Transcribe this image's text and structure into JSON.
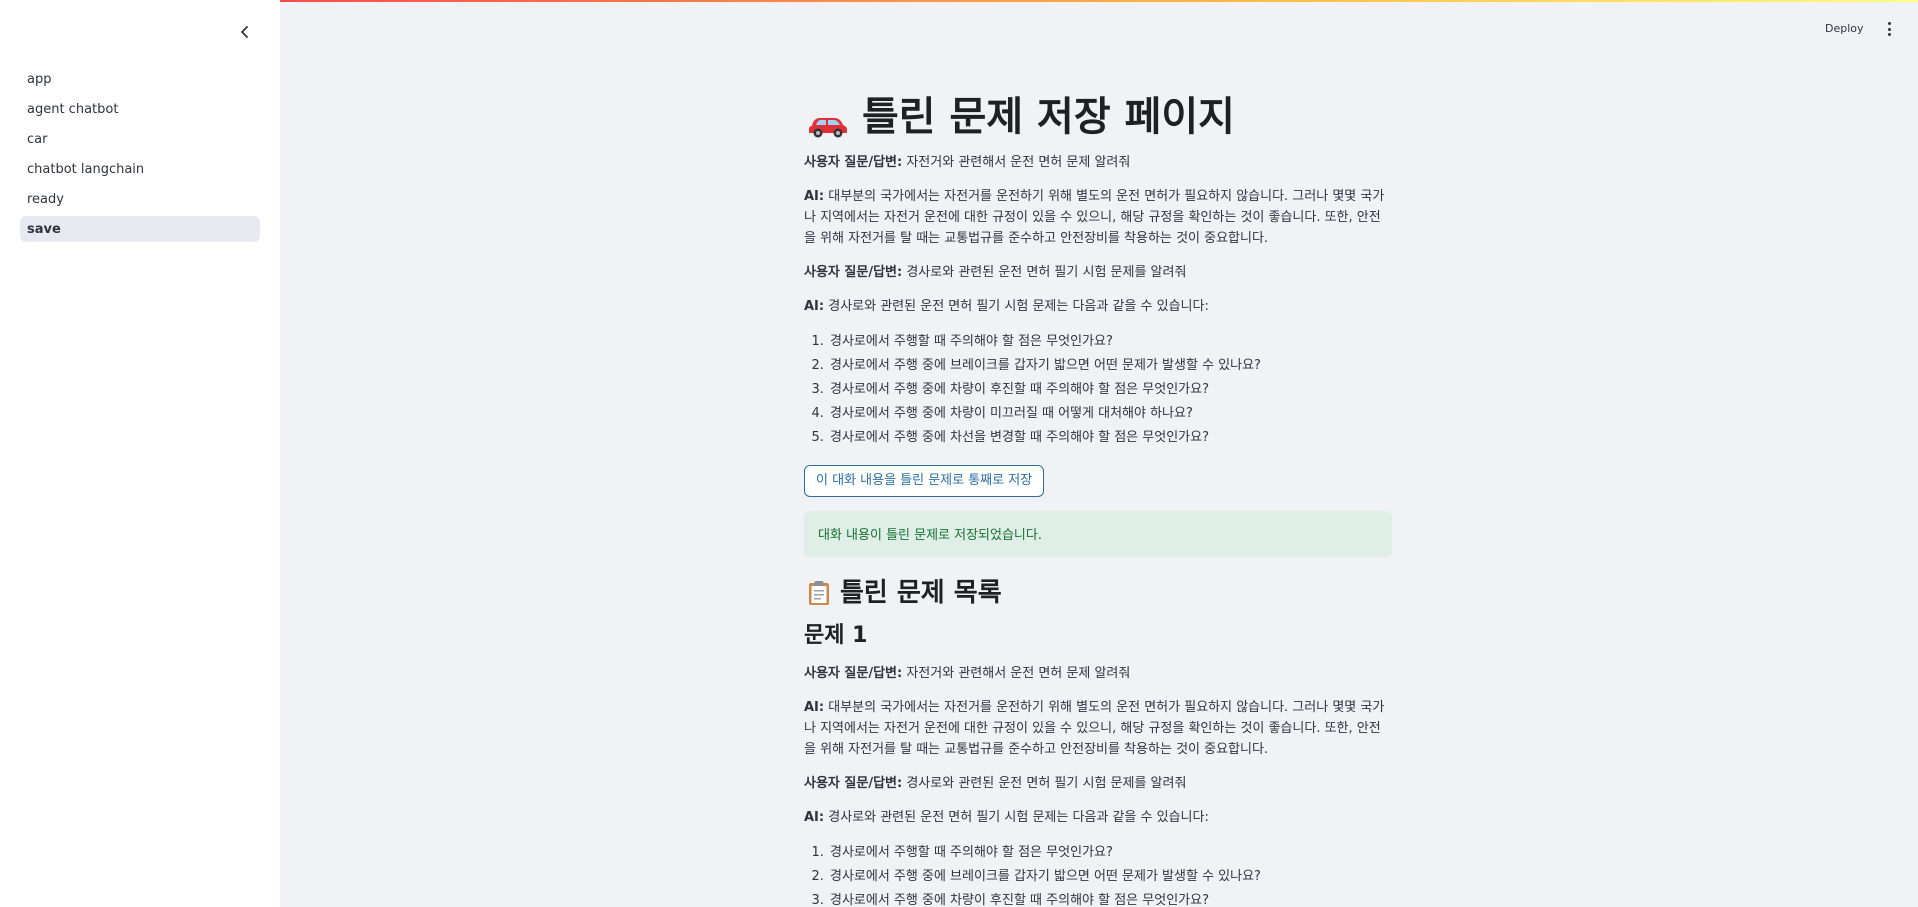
{
  "sidebar": {
    "items": [
      {
        "label": "app",
        "active": false
      },
      {
        "label": "agent chatbot",
        "active": false
      },
      {
        "label": "car",
        "active": false
      },
      {
        "label": "chatbot langchain",
        "active": false
      },
      {
        "label": "ready",
        "active": false
      },
      {
        "label": "save",
        "active": true
      }
    ]
  },
  "header": {
    "deploy_label": "Deploy"
  },
  "main": {
    "title": "틀린 문제 저장 페이지",
    "title_icon": "car-icon",
    "conversation": [
      {
        "prefix": "사용자 질문/답변:",
        "text": "자전거와 관련해서 운전 면허 문제 알려줘"
      },
      {
        "prefix": "AI:",
        "text": "대부분의 국가에서는 자전거를 운전하기 위해 별도의 운전 면허가 필요하지 않습니다. 그러나 몇몇 국가나 지역에서는 자전거 운전에 대한 규정이 있을 수 있으니, 해당 규정을 확인하는 것이 좋습니다. 또한, 안전을 위해 자전거를 탈 때는 교통법규를 준수하고 안전장비를 착용하는 것이 중요합니다."
      },
      {
        "prefix": "사용자 질문/답변:",
        "text": "경사로와 관련된 운전 면허 필기 시험 문제를 알려줘"
      },
      {
        "prefix": "AI:",
        "text": "경사로와 관련된 운전 면허 필기 시험 문제는 다음과 같을 수 있습니다:"
      }
    ],
    "questions": [
      "경사로에서 주행할 때 주의해야 할 점은 무엇인가요?",
      "경사로에서 주행 중에 브레이크를 갑자기 밟으면 어떤 문제가 발생할 수 있나요?",
      "경사로에서 주행 중에 차량이 후진할 때 주의해야 할 점은 무엇인가요?",
      "경사로에서 주행 중에 차량이 미끄러질 때 어떻게 대처해야 하나요?",
      "경사로에서 주행 중에 차선을 변경할 때 주의해야 할 점은 무엇인가요?"
    ],
    "save_button": "이 대화 내용을 틀린 문제로 통째로 저장",
    "success_message": "대화 내용이 틀린 문제로 저장되었습니다.",
    "list_title": "틀린 문제 목록",
    "list_icon": "clipboard-icon",
    "problem_heading": "문제 1",
    "problem_conversation": [
      {
        "prefix": "사용자 질문/답변:",
        "text": "자전거와 관련해서 운전 면허 문제 알려줘"
      },
      {
        "prefix": "AI:",
        "text": "대부분의 국가에서는 자전거를 운전하기 위해 별도의 운전 면허가 필요하지 않습니다. 그러나 몇몇 국가나 지역에서는 자전거 운전에 대한 규정이 있을 수 있으니, 해당 규정을 확인하는 것이 좋습니다. 또한, 안전을 위해 자전거를 탈 때는 교통법규를 준수하고 안전장비를 착용하는 것이 중요합니다."
      },
      {
        "prefix": "사용자 질문/답변:",
        "text": "경사로와 관련된 운전 면허 필기 시험 문제를 알려줘"
      },
      {
        "prefix": "AI:",
        "text": "경사로와 관련된 운전 면허 필기 시험 문제는 다음과 같을 수 있습니다:"
      }
    ],
    "problem_questions": [
      "경사로에서 주행할 때 주의해야 할 점은 무엇인가요?",
      "경사로에서 주행 중에 브레이크를 갑자기 밟으면 어떤 문제가 발생할 수 있나요?",
      "경사로에서 주행 중에 차량이 후진할 때 주의해야 할 점은 무엇인가요?"
    ]
  },
  "colors": {
    "accent_button": "#2d6ea1",
    "success_bg": "#dfeee6",
    "success_text": "#177233",
    "sidebar_active": "#e6e9ef"
  }
}
